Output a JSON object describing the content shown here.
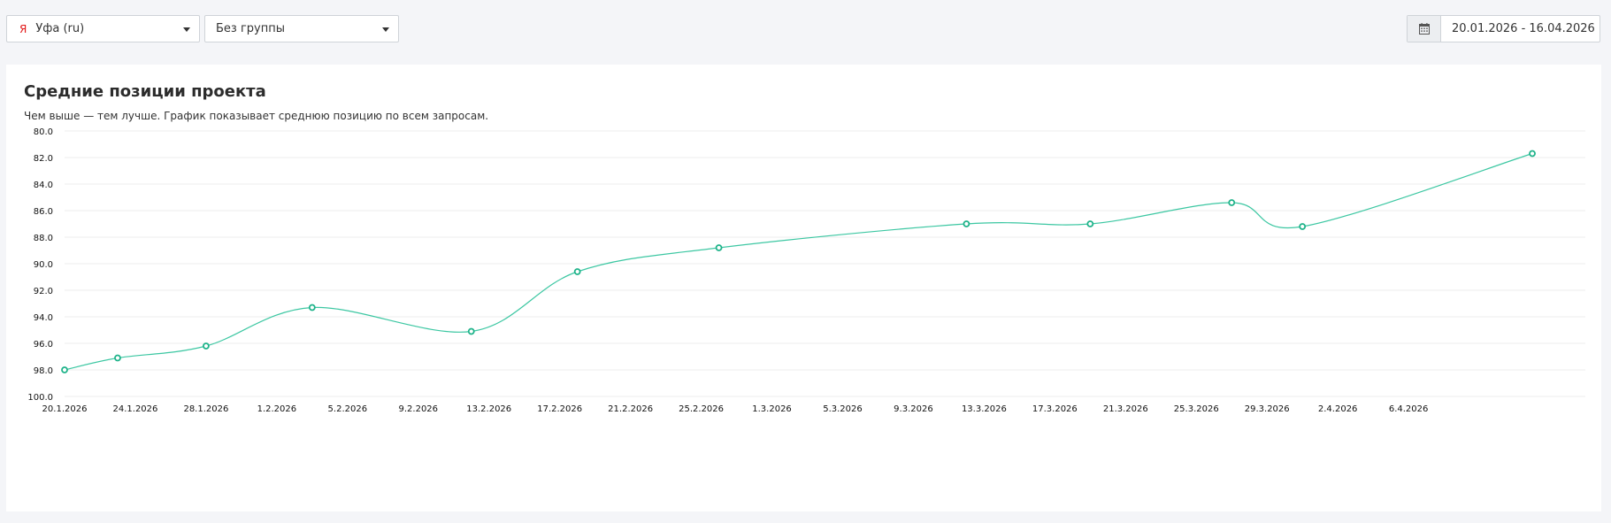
{
  "filters": {
    "region": {
      "logo": "Я",
      "label": "Уфа (ru)"
    },
    "group": {
      "label": "Без группы"
    },
    "date_range": {
      "icon": "calendar-icon",
      "value": "20.01.2026 - 16.04.2026"
    }
  },
  "card": {
    "title": "Средние позиции проекта",
    "subtitle": "Чем выше — тем лучше. График показывает среднюю позицию по всем запросам."
  },
  "chart_data": {
    "type": "line",
    "title": "Средние позиции проекта",
    "ylim": [
      80,
      100
    ],
    "y_inverted": true,
    "y_ticks": [
      "80.0",
      "82.0",
      "84.0",
      "86.0",
      "88.0",
      "90.0",
      "92.0",
      "94.0",
      "96.0",
      "98.0",
      "100.0"
    ],
    "x_range": [
      "2026-01-20",
      "2026-04-16"
    ],
    "x_ticks": [
      "20.1.2026",
      "24.1.2026",
      "28.1.2026",
      "1.2.2026",
      "5.2.2026",
      "9.2.2026",
      "13.2.2026",
      "17.2.2026",
      "21.2.2026",
      "25.2.2026",
      "1.3.2026",
      "5.3.2026",
      "9.3.2026",
      "13.3.2026",
      "17.3.2026",
      "21.3.2026",
      "25.3.2026",
      "29.3.2026",
      "2.4.2026",
      "6.4.2026"
    ],
    "grid": true,
    "color": "#3cc7a2",
    "series": [
      {
        "points": [
          {
            "x": "2026-01-20",
            "y": 98.0
          },
          {
            "x": "2026-01-23",
            "y": 97.1
          },
          {
            "x": "2026-01-28",
            "y": 96.2
          },
          {
            "x": "2026-02-03",
            "y": 93.3
          },
          {
            "x": "2026-02-12",
            "y": 95.1
          },
          {
            "x": "2026-02-18",
            "y": 90.6
          },
          {
            "x": "2026-02-26",
            "y": 88.8
          },
          {
            "x": "2026-03-12",
            "y": 87.0
          },
          {
            "x": "2026-03-19",
            "y": 87.0
          },
          {
            "x": "2026-03-27",
            "y": 85.4
          },
          {
            "x": "2026-03-31",
            "y": 87.2
          },
          {
            "x": "2026-04-13",
            "y": 81.7
          }
        ]
      }
    ]
  }
}
